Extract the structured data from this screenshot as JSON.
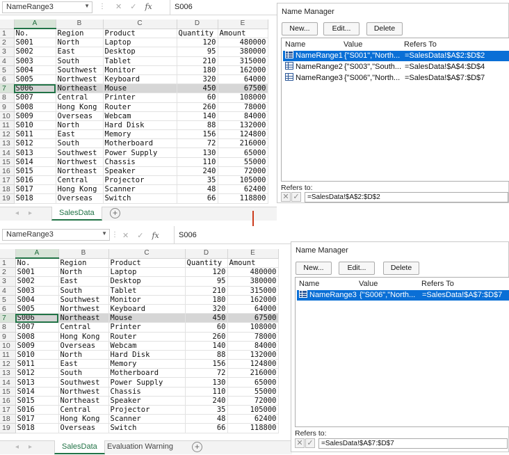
{
  "colors": {
    "accent": "#217346",
    "selection": "#0a6fd6",
    "arrow": "#cc3b1c"
  },
  "columns": [
    "A",
    "B",
    "C",
    "D",
    "E"
  ],
  "rows": [
    {
      "n": "1",
      "a": "No.",
      "b": "Region",
      "c": "Product",
      "d": "Quantity",
      "e": "Amount"
    },
    {
      "n": "2",
      "a": "S001",
      "b": "North",
      "c": "Laptop",
      "d": "120",
      "e": "480000"
    },
    {
      "n": "3",
      "a": "S002",
      "b": "East",
      "c": "Desktop",
      "d": "95",
      "e": "380000"
    },
    {
      "n": "4",
      "a": "S003",
      "b": "South",
      "c": "Tablet",
      "d": "210",
      "e": "315000"
    },
    {
      "n": "5",
      "a": "S004",
      "b": "Southwest",
      "c": "Monitor",
      "d": "180",
      "e": "162000"
    },
    {
      "n": "6",
      "a": "S005",
      "b": "Northwest",
      "c": "Keyboard",
      "d": "320",
      "e": "64000"
    },
    {
      "n": "7",
      "a": "S006",
      "b": "Northeast",
      "c": "Mouse",
      "d": "450",
      "e": "67500"
    },
    {
      "n": "8",
      "a": "S007",
      "b": "Central",
      "c": "Printer",
      "d": "60",
      "e": "108000"
    },
    {
      "n": "9",
      "a": "S008",
      "b": "Hong Kong",
      "c": "Router",
      "d": "260",
      "e": "78000"
    },
    {
      "n": "10",
      "a": "S009",
      "b": "Overseas",
      "c": "Webcam",
      "d": "140",
      "e": "84000"
    },
    {
      "n": "11",
      "a": "S010",
      "b": "North",
      "c": "Hard Disk",
      "d": "88",
      "e": "132000"
    },
    {
      "n": "12",
      "a": "S011",
      "b": "East",
      "c": "Memory",
      "d": "156",
      "e": "124800"
    },
    {
      "n": "13",
      "a": "S012",
      "b": "South",
      "c": "Motherboard",
      "d": "72",
      "e": "216000"
    },
    {
      "n": "14",
      "a": "S013",
      "b": "Southwest",
      "c": "Power Supply",
      "d": "130",
      "e": "65000"
    },
    {
      "n": "15",
      "a": "S014",
      "b": "Northwest",
      "c": "Chassis",
      "d": "110",
      "e": "55000"
    },
    {
      "n": "16",
      "a": "S015",
      "b": "Northeast",
      "c": "Speaker",
      "d": "240",
      "e": "72000"
    },
    {
      "n": "17",
      "a": "S016",
      "b": "Central",
      "c": "Projector",
      "d": "35",
      "e": "105000"
    },
    {
      "n": "18",
      "a": "S017",
      "b": "Hong Kong",
      "c": "Scanner",
      "d": "48",
      "e": "62400"
    },
    {
      "n": "19",
      "a": "S018",
      "b": "Overseas",
      "c": "Switch",
      "d": "66",
      "e": "118800"
    }
  ],
  "highlight_row": "7",
  "top": {
    "name_box": "NameRange3",
    "formula": "S006",
    "tabs": [
      {
        "label": "SalesData",
        "active": true
      }
    ],
    "name_manager": {
      "title": "Name Manager",
      "buttons": {
        "new": "New...",
        "edit": "Edit...",
        "delete": "Delete"
      },
      "headers": {
        "name": "Name",
        "value": "Value",
        "refers": "Refers To"
      },
      "entries": [
        {
          "name": "NameRange1",
          "value": "{\"S001\",\"North...",
          "refers": "=SalesData!$A$2:$D$2",
          "selected": true
        },
        {
          "name": "NameRange2",
          "value": "{\"S003\",\"South...",
          "refers": "=SalesData!$A$4:$D$4",
          "selected": false
        },
        {
          "name": "NameRange3",
          "value": "{\"S006\",\"North...",
          "refers": "=SalesData!$A$7:$D$7",
          "selected": false
        }
      ],
      "refers_to_label": "Refers to:",
      "refers_to_value": "=SalesData!$A$2:$D$2"
    }
  },
  "bottom": {
    "name_box": "NameRange3",
    "formula": "S006",
    "tabs": [
      {
        "label": "SalesData",
        "active": true
      },
      {
        "label": "Evaluation Warning",
        "active": false
      }
    ],
    "name_manager": {
      "title": "Name Manager",
      "buttons": {
        "new": "New...",
        "edit": "Edit...",
        "delete": "Delete"
      },
      "headers": {
        "name": "Name",
        "value": "Value",
        "refers": "Refers To"
      },
      "entries": [
        {
          "name": "NameRange3",
          "value": "{\"S006\",\"North...",
          "refers": "=SalesData!$A$7:$D$7",
          "selected": true
        }
      ],
      "refers_to_label": "Refers to:",
      "refers_to_value": "=SalesData!$A$7:$D$7"
    }
  }
}
